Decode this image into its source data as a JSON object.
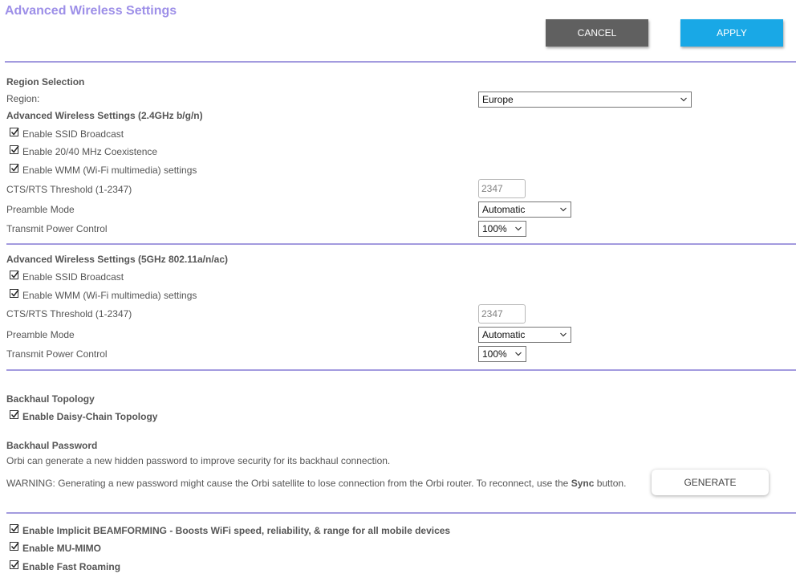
{
  "page": {
    "title": "Advanced Wireless Settings"
  },
  "actions": {
    "cancel_label": "CANCEL",
    "apply_label": "APPLY"
  },
  "region": {
    "heading": "Region Selection",
    "label": "Region:",
    "value": "Europe"
  },
  "band24": {
    "heading": "Advanced Wireless Settings (2.4GHz b/g/n)",
    "ssid_broadcast": {
      "label": "Enable SSID Broadcast",
      "checked": true
    },
    "coexistence": {
      "label": "Enable 20/40 MHz Coexistence",
      "checked": true
    },
    "wmm": {
      "label": "Enable WMM (Wi-Fi multimedia) settings",
      "checked": true
    },
    "cts_label": "CTS/RTS Threshold (1-2347)",
    "cts_value": "2347",
    "preamble_label": "Preamble Mode",
    "preamble_value": "Automatic",
    "power_label": "Transmit Power Control",
    "power_value": "100%"
  },
  "band5": {
    "heading": "Advanced Wireless Settings (5GHz 802.11a/n/ac)",
    "ssid_broadcast": {
      "label": "Enable SSID Broadcast",
      "checked": true
    },
    "wmm": {
      "label": "Enable WMM (Wi-Fi multimedia) settings",
      "checked": true
    },
    "cts_label": "CTS/RTS Threshold (1-2347)",
    "cts_value": "2347",
    "preamble_label": "Preamble Mode",
    "preamble_value": "Automatic",
    "power_label": "Transmit Power Control",
    "power_value": "100%"
  },
  "backhaul": {
    "topology_heading": "Backhaul Topology",
    "daisy_chain": {
      "label": "Enable Daisy-Chain Topology",
      "checked": true
    },
    "password_heading": "Backhaul Password",
    "description": "Orbi can generate a new hidden password to improve security for its backhaul connection.",
    "warning_prefix": "WARNING: Generating a new password might cause the Orbi satellite to lose connection from the Orbi router. To reconnect, use the ",
    "warning_sync": "Sync",
    "warning_suffix": " button.",
    "generate_label": "GENERATE"
  },
  "features": {
    "beamforming": {
      "label": "Enable Implicit BEAMFORMING - Boosts WiFi speed, reliability, & range for all mobile devices",
      "checked": true
    },
    "mu_mimo": {
      "label": "Enable MU-MIMO",
      "checked": true
    },
    "fast_roaming": {
      "label": "Enable Fast Roaming",
      "checked": true
    }
  },
  "colors": {
    "title": "#9d8fe8",
    "divider": "#a39bdf",
    "cancel_bg": "#606060",
    "apply_bg": "#19a8e6"
  }
}
